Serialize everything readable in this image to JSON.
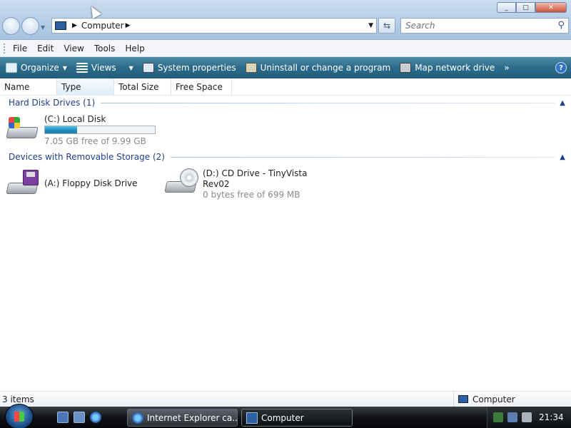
{
  "window": {
    "minimize_label": "_",
    "maximize_label": "□",
    "close_label": "✕"
  },
  "address": {
    "crumb": "Computer"
  },
  "search": {
    "placeholder": "Search"
  },
  "menu": {
    "items": [
      "File",
      "Edit",
      "View",
      "Tools",
      "Help"
    ]
  },
  "commands": {
    "organize": "Organize",
    "views": "Views",
    "system_properties": "System properties",
    "uninstall": "Uninstall or change a program",
    "map_drive": "Map network drive",
    "more": "»"
  },
  "columns": [
    "Name",
    "Type",
    "Total Size",
    "Free Space"
  ],
  "groups": {
    "hard_disk": {
      "title": "Hard Disk Drives (1)",
      "items": [
        {
          "name": "(C:) Local Disk",
          "free_text": "7.05 GB free of 9.99 GB",
          "used_fraction": 0.294
        }
      ]
    },
    "removable": {
      "title": "Devices with Removable Storage (2)",
      "items": [
        {
          "name": "(A:) Floppy Disk Drive"
        },
        {
          "name": "(D:) CD Drive - TinyVista",
          "name_line2": "Rev02",
          "free_text": "0 bytes free of 699 MB"
        }
      ]
    }
  },
  "status": {
    "items_count": "3 items",
    "location": "Computer"
  },
  "taskbar": {
    "tasks": [
      "Internet Explorer ca...",
      "Computer"
    ],
    "clock": "21:34"
  },
  "icons": {
    "help": "?",
    "search": "⚲",
    "refresh": "⇆"
  }
}
